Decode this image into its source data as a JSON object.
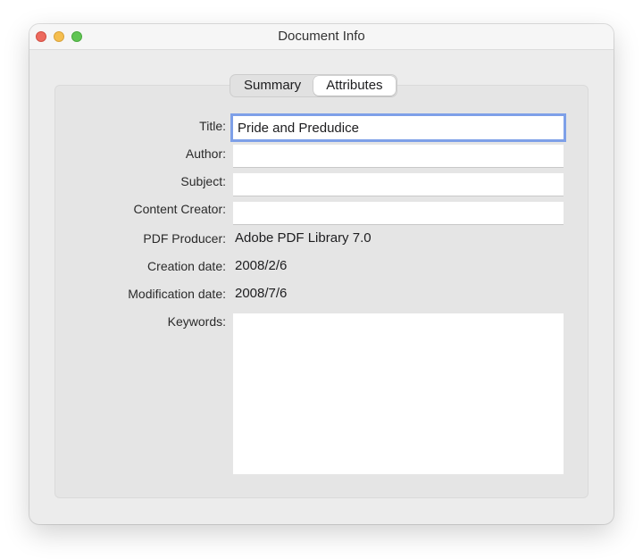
{
  "window": {
    "title": "Document Info"
  },
  "tabs": [
    {
      "label": "Summary",
      "active": false
    },
    {
      "label": "Attributes",
      "active": true
    }
  ],
  "fields": {
    "title": {
      "label": "Title:",
      "value": "Pride and Predudice"
    },
    "author": {
      "label": "Author:",
      "value": ""
    },
    "subject": {
      "label": "Subject:",
      "value": ""
    },
    "content_creator": {
      "label": "Content Creator:",
      "value": ""
    },
    "pdf_producer": {
      "label": "PDF Producer:",
      "value": "Adobe PDF Library 7.0"
    },
    "creation_date": {
      "label": "Creation date:",
      "value": "2008/2/6"
    },
    "modification_date": {
      "label": "Modification date:",
      "value": "2008/7/6"
    },
    "keywords": {
      "label": "Keywords:",
      "value": ""
    }
  },
  "colors": {
    "close": "#ed6a5e",
    "minimize": "#f5be4f",
    "maximize": "#61c554",
    "focus_ring": "#7ea0e8"
  }
}
